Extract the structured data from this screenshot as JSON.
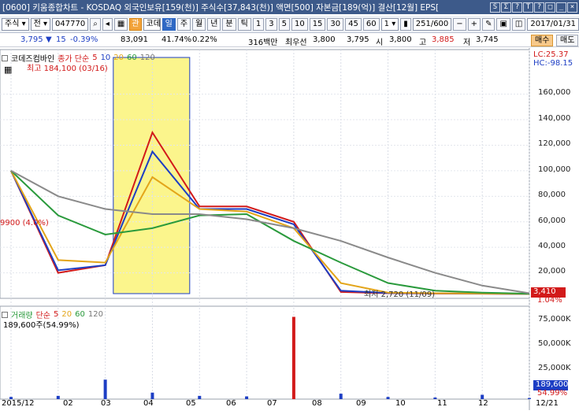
{
  "window": {
    "title": "[0600] 키움종합차트 - KOSDAQ 외국인보유[159(천)] 주식수[37,843(천)] 액면[500] 자본금[189(억)] 결산[12월] EPS[",
    "buttons": [
      "S",
      "Σ",
      "?",
      "T",
      "?",
      "□",
      "_",
      "×"
    ]
  },
  "toolbar": {
    "type_select": "주식",
    "period_select": "전",
    "code": "047770",
    "name_badge": "관",
    "stock_name": "코데즈컴바인",
    "periods": [
      "일",
      "주",
      "월",
      "년",
      "분",
      "틱"
    ],
    "active_period": "일",
    "intervals": [
      "1",
      "3",
      "5",
      "10",
      "15",
      "30",
      "45",
      "60"
    ],
    "count_select": "1",
    "range": "251/600",
    "date": "2017/01/31"
  },
  "pricebar": {
    "price": "3,795",
    "change": "15",
    "change_pct": "-0.39%",
    "volume": "83,091",
    "vol_ratio": "41.74%",
    "turnover": "0.22%",
    "amount": "316백만",
    "best_ask_label": "최우선",
    "best_ask": "3,800",
    "best_bid": "3,795",
    "open_label": "시",
    "open": "3,800",
    "high_label": "고",
    "high": "3,885",
    "low_label": "저",
    "low": "3,745",
    "buy_label": "매수",
    "sell_label": "매도"
  },
  "price_panel": {
    "legend_name": "코데즈컴바인",
    "legend_ma": "종가 단순",
    "legend_periods": [
      "5",
      "10",
      "20",
      "60",
      "120"
    ],
    "high_note": "최고 184,100 (03/16)",
    "low_note": "최저 2,720 (11/09)",
    "left_note": "9900 (4.0%)",
    "lc": "LC:25.37",
    "hc": "HC:-98.15",
    "current_tag": "3,410",
    "current_pct": "1.04%"
  },
  "volume_panel": {
    "legend_label": "거래량",
    "legend_ma": "단순",
    "legend_periods": [
      "5",
      "20",
      "60",
      "120"
    ],
    "max_note": "189,600주(54.99%)",
    "current_tag": "189,600",
    "current_pct": "54.99%"
  },
  "x_axis": {
    "labels": [
      "2015/12",
      "02",
      "03",
      "04",
      "05",
      "06",
      "07",
      "08",
      "09",
      "10",
      "11",
      "12",
      "12/21"
    ]
  },
  "chart_data": [
    {
      "type": "line",
      "title": "",
      "ylim": [
        0,
        190000
      ],
      "y_ticks": [
        "20,000",
        "40,000",
        "60,000",
        "80,000",
        "100,000",
        "120,000",
        "140,000",
        "160,000"
      ],
      "x": [
        "2015/12",
        "02",
        "03",
        "04",
        "05",
        "06",
        "07",
        "08",
        "09",
        "10",
        "11",
        "12"
      ],
      "series": [
        {
          "name": "5",
          "color": "#d21a1a",
          "values": [
            100000,
            20000,
            26000,
            130000,
            72000,
            72000,
            60000,
            5000,
            4000,
            3800,
            3600,
            3500
          ]
        },
        {
          "name": "10",
          "color": "#1d3ec4",
          "values": [
            100000,
            22000,
            26000,
            115000,
            70000,
            70000,
            58000,
            6000,
            4200,
            3900,
            3700,
            3500
          ]
        },
        {
          "name": "20",
          "color": "#e3a51a",
          "values": [
            100000,
            30000,
            28000,
            95000,
            70000,
            68000,
            55000,
            12000,
            4500,
            4000,
            3800,
            3500
          ]
        },
        {
          "name": "60",
          "color": "#2a9a3c",
          "values": [
            100000,
            65000,
            50000,
            55000,
            65000,
            66000,
            45000,
            28000,
            12000,
            6000,
            4500,
            3600
          ]
        },
        {
          "name": "120",
          "color": "#8a8a8a",
          "values": [
            100000,
            80000,
            70000,
            66000,
            66000,
            62000,
            55000,
            45000,
            32000,
            20000,
            10000,
            4000
          ]
        }
      ],
      "highlight_range": [
        "02",
        "03"
      ],
      "colors": {
        "up": "#d21a1a",
        "down": "#1d3ec4",
        "highlight": "#fbf58c"
      }
    },
    {
      "type": "bar",
      "title": "",
      "ylim": [
        0,
        80000
      ],
      "y_ticks": [
        "25,000K",
        "50,000K",
        "75,000K"
      ],
      "categories": [
        "2015/12",
        "02",
        "03",
        "04",
        "05",
        "06",
        "07",
        "08",
        "09",
        "10",
        "11",
        "12"
      ],
      "values": [
        2000,
        3000,
        18000,
        6000,
        3000,
        2500,
        76000,
        5000,
        2000,
        1500,
        4000,
        1000
      ]
    }
  ]
}
